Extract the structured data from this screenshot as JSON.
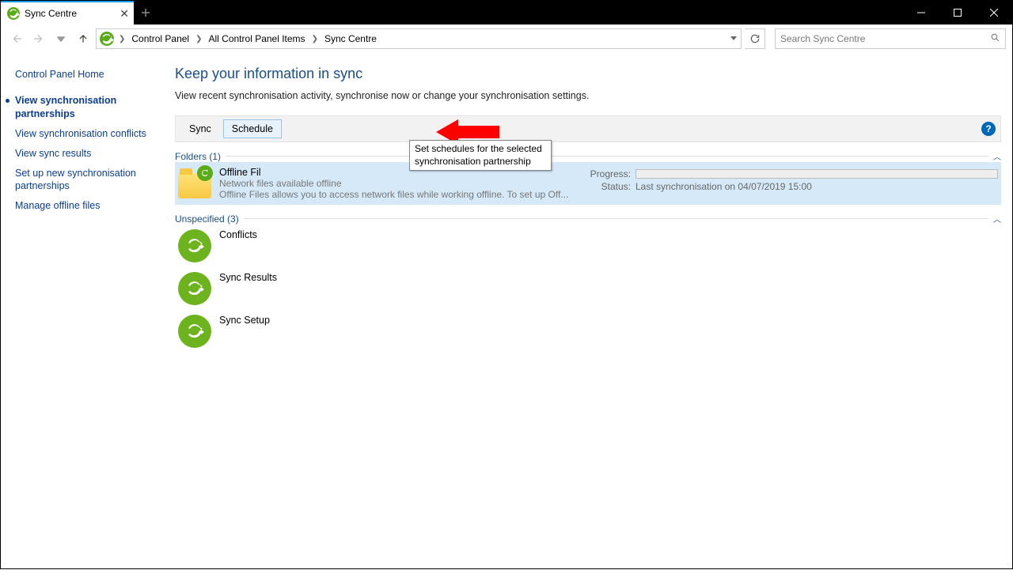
{
  "window": {
    "tab_title": "Sync Centre"
  },
  "breadcrumb": {
    "items": [
      "Control Panel",
      "All Control Panel Items",
      "Sync Centre"
    ]
  },
  "search": {
    "placeholder": "Search Sync Centre"
  },
  "sidebar": {
    "home": "Control Panel Home",
    "links": [
      "View synchronisation partnerships",
      "View synchronisation conflicts",
      "View sync results",
      "Set up new synchronisation partnerships",
      "Manage offline files"
    ],
    "active_index": 0
  },
  "main": {
    "heading": "Keep your information in sync",
    "subtext": "View recent synchronisation activity, synchronise now or change your synchronisation settings."
  },
  "toolbar": {
    "sync": "Sync",
    "schedule": "Schedule"
  },
  "tooltip": {
    "text": "Set schedules for the selected synchronisation partnership"
  },
  "groups": {
    "folders_label": "Folders (1)",
    "unspecified_label": "Unspecified (3)"
  },
  "offline_item": {
    "title": "Offline Fil",
    "sub1": "Network files available offline",
    "sub2": "Offline Files allows you to access network files while working offline. To set up Off...",
    "progress_label": "Progress:",
    "status_label": "Status:",
    "status_value": "Last synchronisation on 04/07/2019 15:00"
  },
  "unspecified_items": [
    {
      "title": "Conflicts"
    },
    {
      "title": "Sync Results"
    },
    {
      "title": "Sync Setup"
    }
  ]
}
